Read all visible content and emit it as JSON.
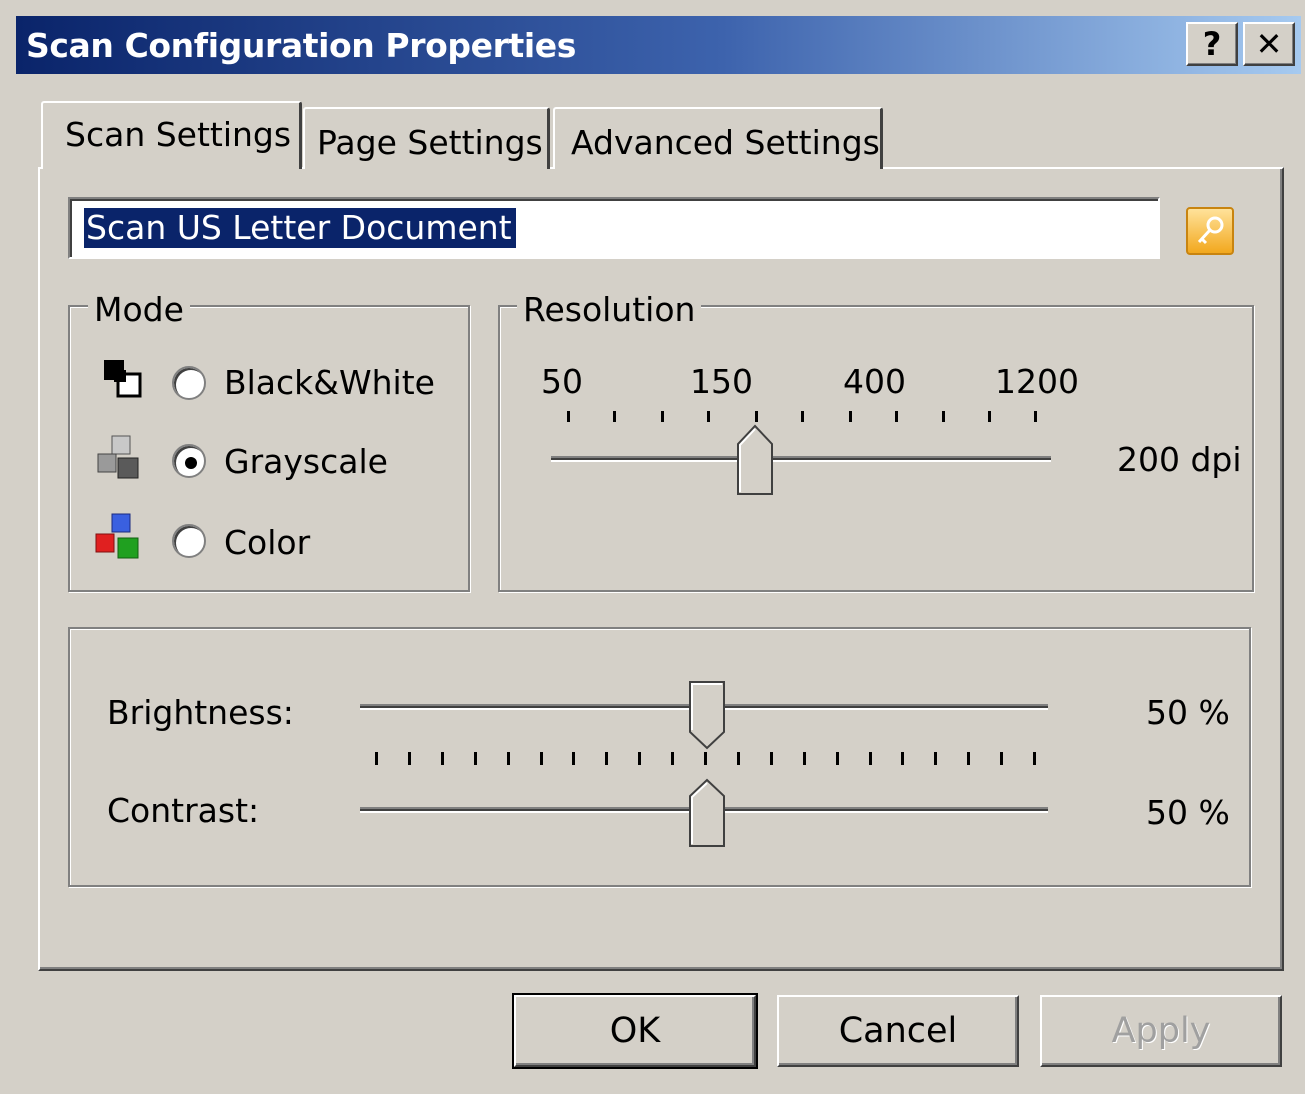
{
  "window": {
    "title": "Scan Configuration Properties",
    "help_label": "?",
    "close_label": "✕"
  },
  "tabs": [
    "Scan Settings",
    "Page Settings",
    "Advanced Settings"
  ],
  "active_tab": "Scan Settings",
  "config_name": {
    "value": "Scan US Letter Document",
    "icon": "key-icon"
  },
  "mode": {
    "legend": "Mode",
    "options": [
      {
        "label": "Black&White",
        "icon": "black-white-icon",
        "selected": false
      },
      {
        "label": "Grayscale",
        "icon": "grayscale-icon",
        "selected": true
      },
      {
        "label": "Color",
        "icon": "color-icon",
        "selected": false
      }
    ]
  },
  "resolution": {
    "legend": "Resolution",
    "scale_labels": [
      "50",
      "150",
      "400",
      "1200"
    ],
    "value_text": "200 dpi",
    "value_dpi": 200
  },
  "adjustments": {
    "brightness": {
      "label": "Brightness:",
      "value_text": "50 %",
      "value_percent": 50
    },
    "contrast": {
      "label": "Contrast:",
      "value_text": "50 %",
      "value_percent": 50
    }
  },
  "buttons": {
    "ok": "OK",
    "cancel": "Cancel",
    "apply": "Apply"
  },
  "colors": {
    "title_start": "#0a246a",
    "title_end": "#a6caf0",
    "face": "#d4d0c8",
    "selection": "#0a246a"
  }
}
